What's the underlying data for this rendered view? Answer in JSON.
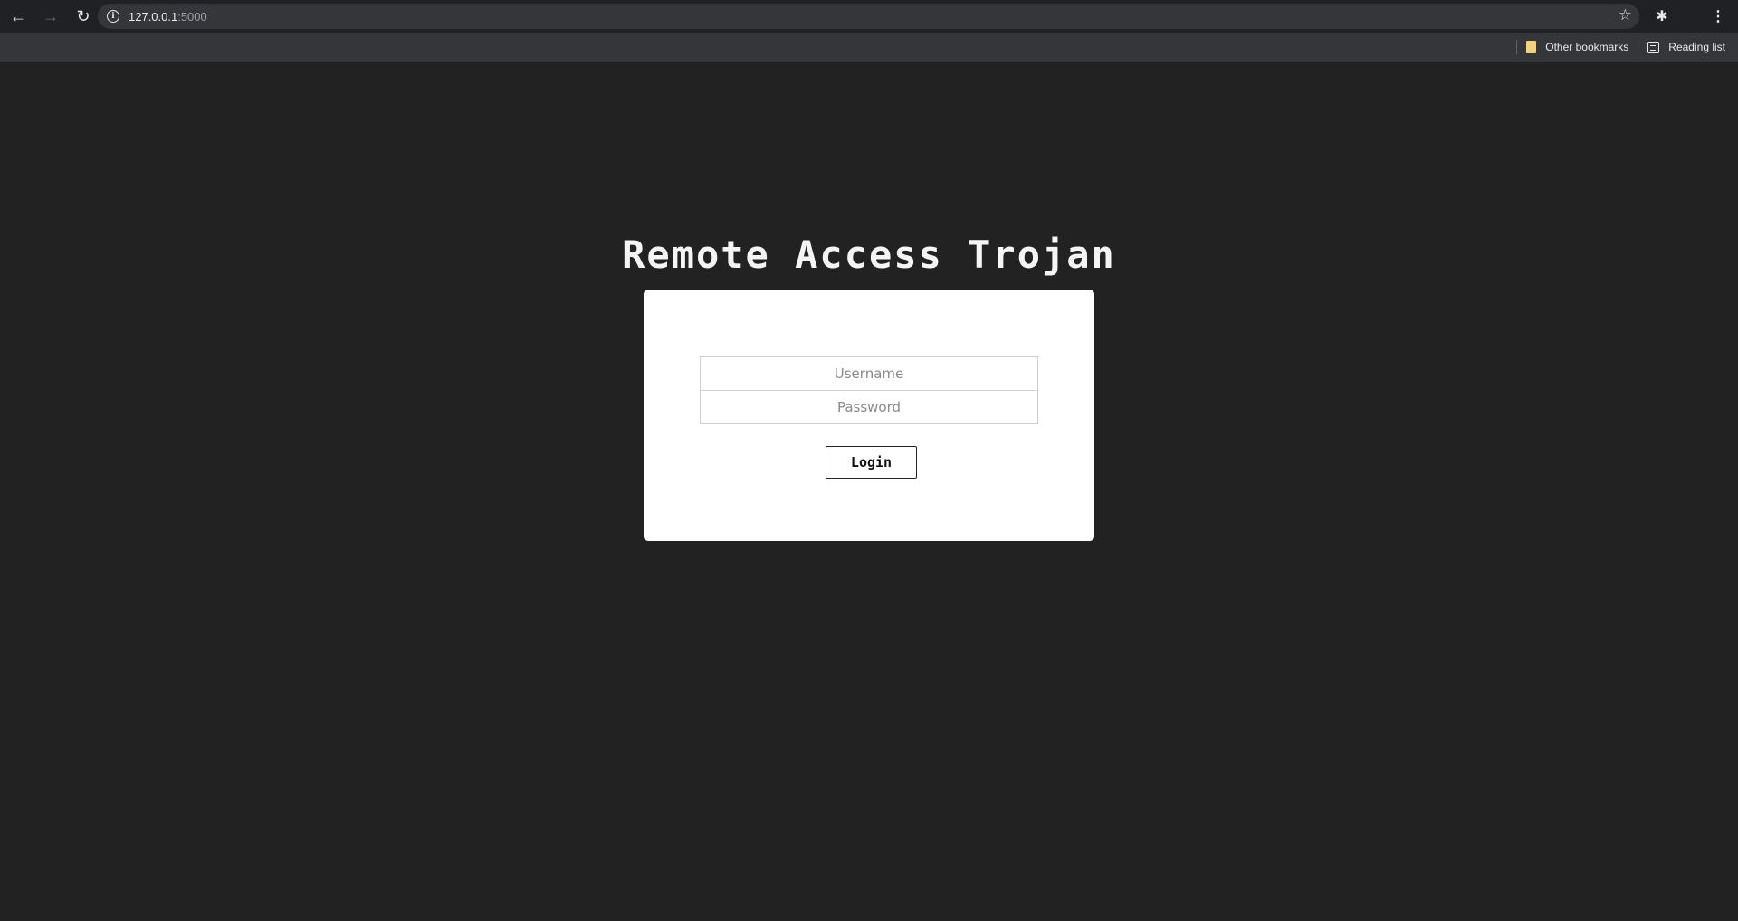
{
  "browser": {
    "url_host": "127.0.0.1",
    "url_port": ":5000",
    "back_icon": "←",
    "forward_icon": "→",
    "reload_icon": "↻",
    "info_icon": "i",
    "star_icon": "☆",
    "extensions_icon": "✱",
    "menu_icon": "⋮"
  },
  "bookmarks": {
    "other_bookmarks": "Other bookmarks",
    "reading_list": "Reading list"
  },
  "page": {
    "title": "Remote Access Trojan",
    "username_placeholder": "Username",
    "password_placeholder": "Password",
    "login_label": "Login"
  }
}
